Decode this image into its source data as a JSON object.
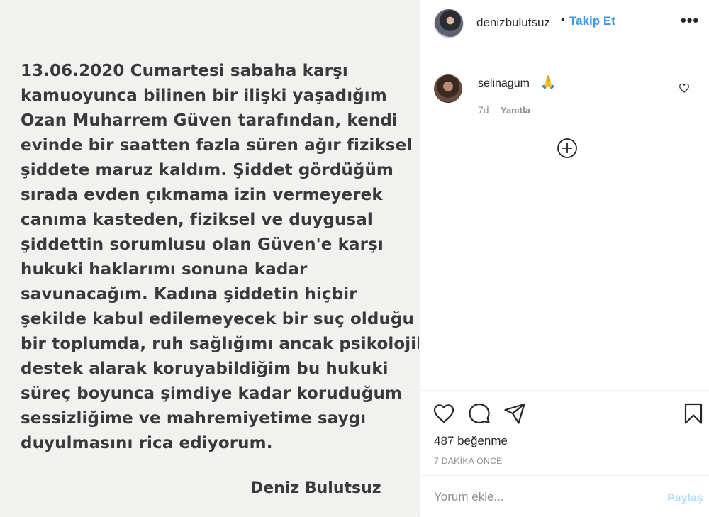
{
  "post": {
    "statement_lines": [
      "13.06.2020 Cumartesi sabaha karşı",
      "kamuoyunca bilinen bir ilişki yaşadığım",
      "Ozan Muharrem Güven tarafından, kendi",
      "evinde bir saatten fazla süren ağır fiziksel",
      "şiddete maruz kaldım. Şiddet gördüğüm",
      "sırada evden çıkmama izin vermeyerek",
      "canıma kasteden, fiziksel ve duygusal",
      "şiddettin sorumlusu olan Güven'e karşı",
      "hukuki haklarımı sonuna kadar",
      "savunacağım. Kadına şiddetin hiçbir",
      "şekilde kabul edilemeyecek bir suç olduğu",
      "bir toplumda, ruh sağlığımı ancak psikolojik",
      "destek alarak koruyabildiğim bu hukuki",
      "süreç boyunca şimdiye kadar koruduğum",
      "sessizliğime ve mahremiyetime saygı",
      "duyulmasını rica ediyorum."
    ],
    "signature": "Deniz Bulutsuz"
  },
  "header": {
    "username": "denizbulutsuz",
    "separator": "•",
    "follow_label": "Takip Et",
    "more_icon": "more-horizontal-icon",
    "more_glyph": "•••"
  },
  "comment": {
    "username": "selinagum",
    "text": "🙏",
    "time": "7d",
    "reply_label": "Yanıtla"
  },
  "actions": {
    "likes": "487 beğenme",
    "time_ago": "7 DAKİKA ÖNCE"
  },
  "comment_box": {
    "placeholder": "Yorum ekle...",
    "submit_label": "Paylaş"
  },
  "colors": {
    "accent": "#3897f0",
    "accent_disabled": "#b2dffc",
    "muted": "#8e8e8e",
    "text": "#262626",
    "border": "#efefef"
  }
}
